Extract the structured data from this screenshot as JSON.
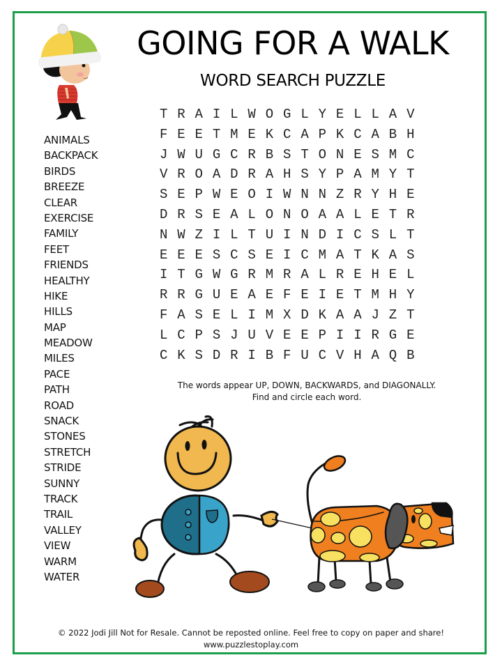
{
  "header": {
    "title": "GOING FOR A WALK",
    "subtitle": "WORD SEARCH PUZZLE"
  },
  "word_list": [
    "ANIMALS",
    "BACKPACK",
    "BIRDS",
    "BREEZE",
    "CLEAR",
    "EXERCISE",
    "FAMILY",
    "FEET",
    "FRIENDS",
    "HEALTHY",
    "HIKE",
    "HILLS",
    "MAP",
    "MEADOW",
    "MILES",
    "PACE",
    "PATH",
    "ROAD",
    "SNACK",
    "STONES",
    "STRETCH",
    "STRIDE",
    "SUNNY",
    "TRACK",
    "TRAIL",
    "VALLEY",
    "VIEW",
    "WARM",
    "WATER"
  ],
  "grid": [
    "TRAILWOGLYELLAV",
    "FEETMEKCAPKCABH",
    "JWUGCRBSTONESMC",
    "VROADRAHSYPAMYT",
    "SEPWEOIWNNZRYHE",
    "DRSEALONOAALETR",
    "NWZILTUINDICSLT",
    "EEESCSEICMATKAS",
    "ITGWGRMRALREHEL",
    "RRGUEAEFEIETMHY",
    "FASELIMXDKAAJZT",
    "LCPSJUVEEPIIRGE",
    "CKSDRIBFUCVHAQB"
  ],
  "instructions": {
    "line1": "The words appear UP, DOWN, BACKWARDS, and DIAGONALLY.",
    "line2": "Find and circle each word."
  },
  "footer": {
    "copyright": "© 2022  Jodi Jill Not for Resale. Cannot be reposted online. Feel free to copy on paper and share!",
    "website": "www.puzzlestoplay.com"
  },
  "illustrations": {
    "top_left": "boy-walking-icon",
    "bottom": "stick-figure-walking-dog-icon"
  },
  "colors": {
    "border": "#1a9e4a",
    "hat_yellow": "#f6d24a",
    "hat_green": "#9cc74a",
    "shirt_red": "#d93a2f",
    "face_orange": "#f0b84e",
    "body_dark_blue": "#1f6f8b",
    "body_light_blue": "#3aa3c9",
    "shoe_brown": "#a34a1e",
    "dog_orange": "#f07f1f",
    "dog_spot": "#f8e060",
    "dog_gray": "#555555"
  }
}
